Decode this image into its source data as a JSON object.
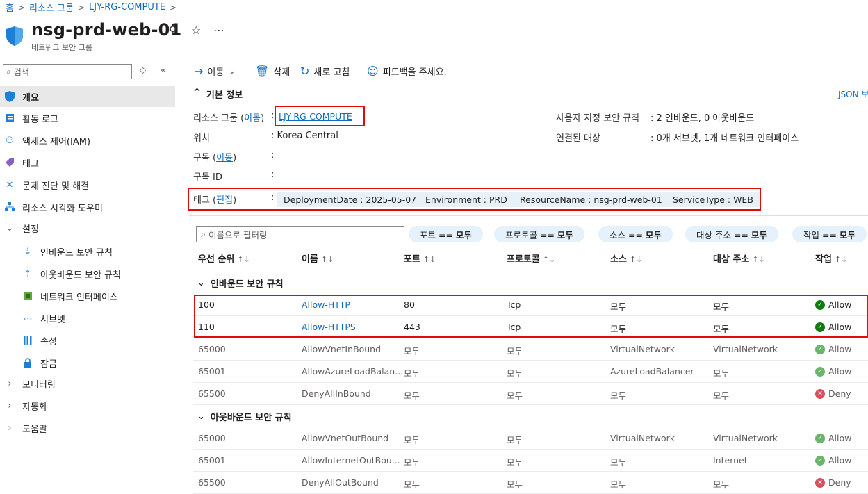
{
  "breadcrumb": {
    "home": "홈",
    "resource_groups": "리소스 그룹",
    "rg": "LJY-RG-COMPUTE"
  },
  "resource": {
    "title": "nsg-prd-web-01",
    "subtitle": "네트워크 보안 그룹"
  },
  "sidebar": {
    "search_placeholder": "검색",
    "items": [
      {
        "label": "개요",
        "icon": "shield-icon"
      },
      {
        "label": "활동 로그",
        "icon": "log-icon"
      },
      {
        "label": "액세스 제어(IAM)",
        "icon": "people-icon"
      },
      {
        "label": "태그",
        "icon": "tag-icon"
      },
      {
        "label": "문제 진단 및 해결",
        "icon": "wrench-icon"
      },
      {
        "label": "리소스 시각화 도우미",
        "icon": "hierarchy-icon"
      },
      {
        "label": "설정",
        "icon": "chevron-down-icon"
      },
      {
        "label": "인바운드 보안 규칙",
        "icon": "inbound-icon"
      },
      {
        "label": "아웃바운드 보안 규칙",
        "icon": "outbound-icon"
      },
      {
        "label": "네트워크 인터페이스",
        "icon": "nic-icon"
      },
      {
        "label": "서브넷",
        "icon": "subnet-icon"
      },
      {
        "label": "속성",
        "icon": "properties-icon"
      },
      {
        "label": "잠금",
        "icon": "lock-icon"
      },
      {
        "label": "모니터링",
        "icon": "chevron-right-icon"
      },
      {
        "label": "자동화",
        "icon": "chevron-right-icon"
      },
      {
        "label": "도움말",
        "icon": "chevron-right-icon"
      }
    ]
  },
  "commands": {
    "move": "이동",
    "delete": "삭제",
    "refresh": "새로 고침",
    "feedback": "피드백을 주세요."
  },
  "essentials": {
    "title": "기본 정보",
    "json_view": "JSON 보",
    "rg_label": "리소스 그룹",
    "move_link": "이동",
    "rg_value": "LJY-RG-COMPUTE",
    "location_label": "위치",
    "location_value": "Korea Central",
    "subscription_label": "구독",
    "subscription_id_label": "구독 ID",
    "custom_rules_label": "사용자 지정 보안 규칙",
    "custom_rules_value": "2 인바운드, 0 아웃바운드",
    "associated_label": "연결된 대상",
    "associated_value": "0개 서브넷, 1개 네트워크 인터페이스",
    "tags_label": "태그",
    "edit_link": "편집",
    "tags": [
      "DeploymentDate : 2025-05-07",
      "Environment : PRD",
      "ResourceName : nsg-prd-web-01",
      "ServiceType : WEB"
    ]
  },
  "filter": {
    "placeholder": "이름으로 필터링",
    "pills": [
      {
        "label": "포트 ==",
        "value": "모두"
      },
      {
        "label": "프로토콜 ==",
        "value": "모두"
      },
      {
        "label": "소스 ==",
        "value": "모두"
      },
      {
        "label": "대상 주소 ==",
        "value": "모두"
      },
      {
        "label": "작업 ==",
        "value": "모두"
      }
    ]
  },
  "table": {
    "columns": [
      "우선 순위",
      "이름",
      "포트",
      "프로토콜",
      "소스",
      "대상 주소",
      "작업"
    ],
    "inbound_title": "인바운드 보안 규칙",
    "outbound_title": "아웃바운드 보안 규칙",
    "inbound": [
      {
        "priority": "100",
        "name": "Allow-HTTP",
        "port": "80",
        "protocol": "Tcp",
        "source": "모두",
        "dest": "모두",
        "action": "Allow"
      },
      {
        "priority": "110",
        "name": "Allow-HTTPS",
        "port": "443",
        "protocol": "Tcp",
        "source": "모두",
        "dest": "모두",
        "action": "Allow"
      },
      {
        "priority": "65000",
        "name": "AllowVnetInBound",
        "port": "모두",
        "protocol": "모두",
        "source": "VirtualNetwork",
        "dest": "VirtualNetwork",
        "action": "Allow"
      },
      {
        "priority": "65001",
        "name": "AllowAzureLoadBalan...",
        "port": "모두",
        "protocol": "모두",
        "source": "AzureLoadBalancer",
        "dest": "모두",
        "action": "Allow"
      },
      {
        "priority": "65500",
        "name": "DenyAllInBound",
        "port": "모두",
        "protocol": "모두",
        "source": "모두",
        "dest": "모두",
        "action": "Deny"
      }
    ],
    "outbound": [
      {
        "priority": "65000",
        "name": "AllowVnetOutBound",
        "port": "모두",
        "protocol": "모두",
        "source": "VirtualNetwork",
        "dest": "VirtualNetwork",
        "action": "Allow"
      },
      {
        "priority": "65001",
        "name": "AllowInternetOutBou...",
        "port": "모두",
        "protocol": "모두",
        "source": "모두",
        "dest": "Internet",
        "action": "Allow"
      },
      {
        "priority": "65500",
        "name": "DenyAllOutBound",
        "port": "모두",
        "protocol": "모두",
        "source": "모두",
        "dest": "모두",
        "action": "Deny"
      }
    ]
  },
  "colors": {
    "accent": "#0f6cbd",
    "highlight_box": "#e00b0b",
    "allow": "#107c10",
    "deny": "#c50f1f"
  }
}
